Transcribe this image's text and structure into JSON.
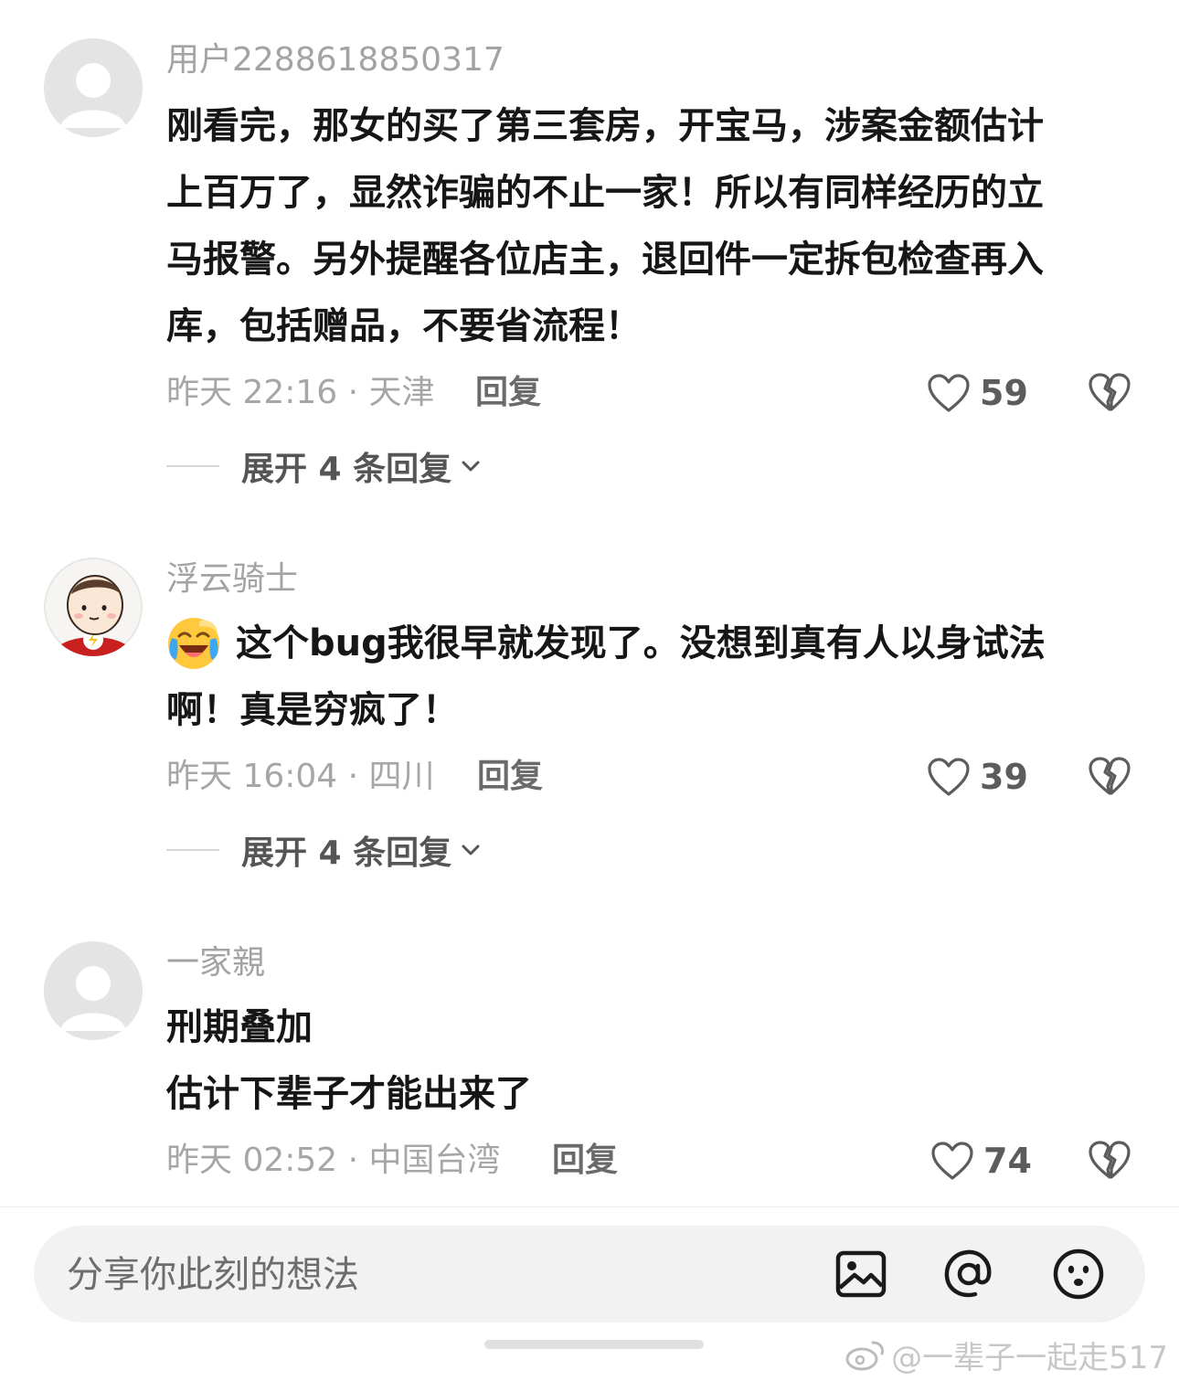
{
  "comments": [
    {
      "username": "用户2288618850317",
      "avatar": "default-avatar-icon",
      "text_lines": [
        "刚看完，那女的买了第三套房，开宝马，涉案金额估计",
        "上百万了，显然诈骗的不止一家！所以有同样经历的立",
        "马报警。另外提醒各位店主，退回件一定拆包检查再入",
        "库，包括赠品，不要省流程！"
      ],
      "meta": "昨天 22:16 · 天津",
      "reply_label": "回复",
      "likes": "59",
      "expand_label": "展开 4 条回复"
    },
    {
      "username": "浮云骑士",
      "avatar": "cartoon-avatar-icon",
      "emoji": "crying-laughing-emoji",
      "text_lines": [
        "这个bug我很早就发现了。没想到真有人以身试法",
        "啊！真是穷疯了！"
      ],
      "meta": "昨天 16:04 · 四川",
      "reply_label": "回复",
      "likes": "39",
      "expand_label": "展开 4 条回复"
    },
    {
      "username": "一家親",
      "avatar": "default-avatar-icon",
      "text_lines": [
        "刑期叠加",
        "估计下辈子才能出来了"
      ],
      "meta": "昨天 02:52 · 中国台湾",
      "reply_label": "回复",
      "likes": "74"
    }
  ],
  "composer": {
    "placeholder": "分享你此刻的想法",
    "icons": [
      "image-icon",
      "at-icon",
      "emoji-icon"
    ]
  },
  "watermark": "@一辈子一起走517"
}
